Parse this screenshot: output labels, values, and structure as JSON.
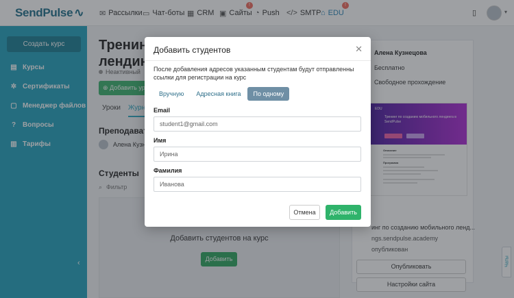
{
  "app": {
    "logo": "SendPulse"
  },
  "topnav": {
    "items": [
      {
        "label": "Рассылки",
        "icon": "mail-icon"
      },
      {
        "label": "Чат-боты",
        "icon": "chat-icon"
      },
      {
        "label": "CRM",
        "icon": "crm-icon"
      },
      {
        "label": "Сайты",
        "icon": "sites-icon",
        "badge": "!"
      },
      {
        "label": "Push",
        "icon": "bell-icon"
      },
      {
        "label": "SMTP",
        "icon": "code-icon"
      },
      {
        "label": "EDU",
        "icon": "edu-icon",
        "badge": "!"
      }
    ]
  },
  "sidebar": {
    "create_label": "Создать курс",
    "items": [
      {
        "label": "Курсы",
        "icon": "courses-icon"
      },
      {
        "label": "Сертификаты",
        "icon": "certificate-icon"
      },
      {
        "label": "Менеджер файлов",
        "icon": "files-icon"
      },
      {
        "label": "Вопросы",
        "icon": "questions-icon"
      },
      {
        "label": "Тарифы",
        "icon": "tariffs-icon"
      }
    ]
  },
  "main": {
    "title_line1": "Тренинг",
    "title_line2": "лендинг",
    "status": "Неактивный",
    "add_button": "Добавить ур",
    "tabs": [
      "Уроки",
      "Журн"
    ],
    "teachers_title": "Преподавате",
    "teacher_name": "Алена Кузн",
    "students_title": "Студенты",
    "filter_placeholder": "Фильтр",
    "empty_text": "Добавить студентов на курс",
    "empty_button": "Добавить"
  },
  "right_panel": {
    "author": "Алена Кузнецова",
    "price": "Бесплатно",
    "mode": "Свободное прохождение",
    "preview_logo": "EDU",
    "preview_title": "Тренинг по созданию мобильного лендинга в SendPulse",
    "preview_headings": [
      "Описание",
      "Программа"
    ],
    "course_name": "инг по созданию мобильного ленд...",
    "domain": "ngs.sendpulse.academy",
    "published": "опубликован",
    "publish_button": "Опубликовать",
    "settings_button": "Настройки сайта"
  },
  "chats_tab": "Чаты",
  "modal": {
    "title": "Добавить студентов",
    "description": "После добавления адресов указанным студентам будут отправленны ссылки для регистрации на курс",
    "tabs": [
      "Вручную",
      "Адресная книга",
      "По одному"
    ],
    "email_label": "Email",
    "email_placeholder": "student1@gmail.com",
    "name_label": "Имя",
    "name_placeholder": "Ирина",
    "surname_label": "Фамилия",
    "surname_placeholder": "Иванова",
    "cancel_label": "Отмена",
    "add_label": "Добавить"
  }
}
